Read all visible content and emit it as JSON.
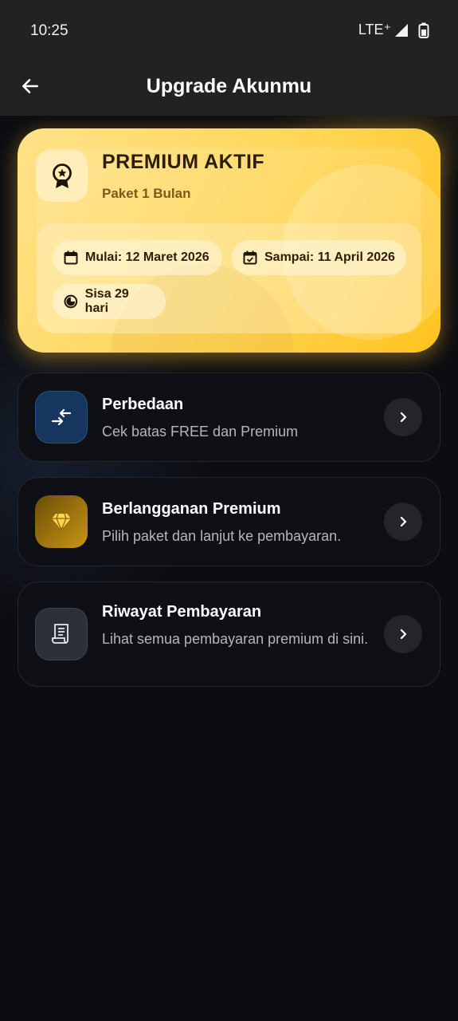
{
  "status": {
    "time": "10:25",
    "network": "LTE⁺"
  },
  "appbar": {
    "title": "Upgrade Akunmu"
  },
  "premium": {
    "title": "PREMIUM AKTIF",
    "plan": "Paket 1 Bulan",
    "start": "Mulai: 12 Maret 2026",
    "end": "Sampai: 11 April 2026",
    "remaining": "Sisa 29 hari"
  },
  "menu": [
    {
      "title": "Perbedaan",
      "desc": "Cek batas FREE dan Premium",
      "icon": "compare-arrows-icon"
    },
    {
      "title": "Berlangganan Premium",
      "desc": "Pilih paket dan lanjut ke pembayaran.",
      "icon": "diamond-icon"
    },
    {
      "title": "Riwayat Pembayaran",
      "desc": "Lihat semua pembayaran premium di sini.",
      "icon": "receipt-icon"
    }
  ],
  "colors": {
    "accent": "#ffd656",
    "background": "#0c0d11",
    "card": "#0f1015"
  }
}
